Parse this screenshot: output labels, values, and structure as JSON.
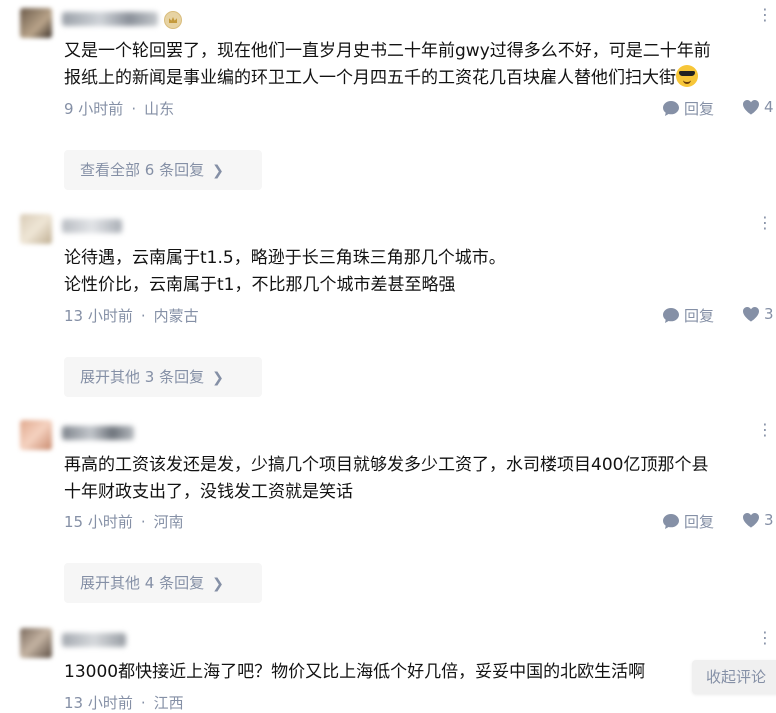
{
  "comments": [
    {
      "lines": [
        "又是一个轮回罢了，现在他们一直岁月史书二十年前gwy过得多么不好，可是二十年前",
        "报纸上的新闻是事业编的环卫工人一个月四五千的工资花几百块雇人替他们扫大街"
      ],
      "time": "9 小时前",
      "location": "山东",
      "reply_label": "回复",
      "likes": "4",
      "expand_label": "查看全部 6 条回复"
    },
    {
      "lines": [
        "论待遇，云南属于t1.5，略逊于长三角珠三角那几个城市。",
        "论性价比，云南属于t1，不比那几个城市差甚至略强"
      ],
      "time": "13 小时前",
      "location": "内蒙古",
      "reply_label": "回复",
      "likes": "3",
      "expand_label": "展开其他 3 条回复"
    },
    {
      "lines": [
        "再高的工资该发还是发，少搞几个项目就够发多少工资了，水司楼项目400亿顶那个县",
        "十年财政支出了，没钱发工资就是笑话"
      ],
      "time": "15 小时前",
      "location": "河南",
      "reply_label": "回复",
      "likes": "3",
      "expand_label": "展开其他 4 条回复"
    },
    {
      "lines": [
        "13000都快接近上海了吧？物价又比上海低个好几倍，妥妥中国的北欧生活啊"
      ],
      "time": "13 小时前",
      "location": "江西"
    }
  ],
  "collapse_label": "收起评论",
  "icons": {
    "reply": "comment-bubble-icon",
    "like": "heart-icon",
    "more": "more-dots-icon",
    "emoji": "sunglasses-emoji-icon",
    "vip": "crown-badge-icon"
  },
  "colors": {
    "text": "#121212",
    "meta": "#8590a6",
    "button_bg": "#f6f6f6"
  }
}
